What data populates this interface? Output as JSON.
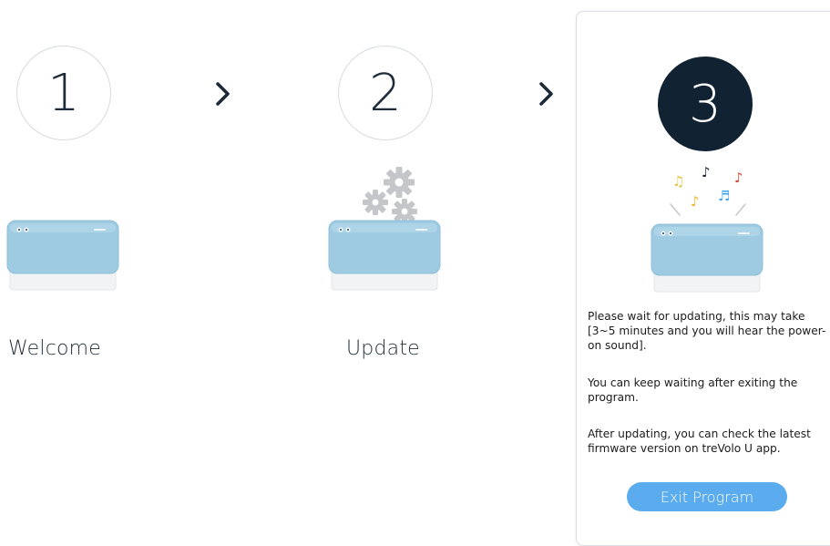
{
  "steps": [
    {
      "number": "1",
      "label": "Welcome",
      "active": false
    },
    {
      "number": "2",
      "label": "Update",
      "active": false
    },
    {
      "number": "3",
      "label": "",
      "active": true
    }
  ],
  "panel": {
    "message_1": "Please wait for updating, this may take [3~5 minutes and you will hear the power-on sound].",
    "message_2": "You can keep waiting after exiting the program.",
    "message_3": "After updating, you can check the latest firmware version on treVolo U app.",
    "exit_label": "Exit Program"
  },
  "colors": {
    "active_circle": "#112233",
    "device_body": "#9ecbe2",
    "button": "#5aacef",
    "gear": "#b9bcc0"
  },
  "icons": {
    "step_arrow": "chevron-right-icon",
    "device": "speaker-device-icon",
    "updating": "gears-icon",
    "sound": "music-notes-icon"
  }
}
